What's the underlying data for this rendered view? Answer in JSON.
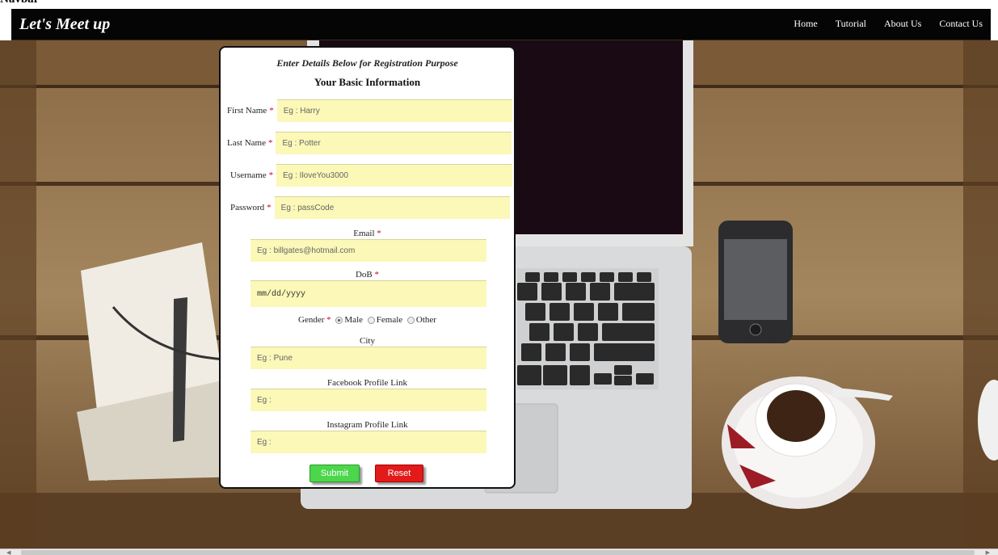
{
  "header": {
    "brand": "Let's Meet up",
    "partial_text": "Navbar"
  },
  "nav": [
    "Home",
    "Tutorial",
    "About Us",
    "Contact Us"
  ],
  "form": {
    "intro": "Enter Details Below for Registration Purpose",
    "heading": "Your Basic Information",
    "required_mark": "*",
    "first_name": {
      "label": "First Name",
      "placeholder": "Eg : Harry"
    },
    "last_name": {
      "label": "Last Name",
      "placeholder": "Eg : Potter"
    },
    "username": {
      "label": "Username",
      "placeholder": "Eg : IloveYou3000"
    },
    "password": {
      "label": "Password",
      "placeholder": "Eg : passCode"
    },
    "email": {
      "label": "Email",
      "placeholder": "Eg : billgates@hotmail.com"
    },
    "dob": {
      "label": "DoB",
      "placeholder": "mm/dd/yyyy"
    },
    "gender": {
      "label": "Gender",
      "options": [
        "Male",
        "Female",
        "Other"
      ],
      "selected": "Male"
    },
    "city": {
      "label": "City",
      "placeholder": "Eg : Pune"
    },
    "facebook": {
      "label": "Facebook Profile Link",
      "placeholder": "Eg :"
    },
    "instagram": {
      "label": "Instagram Profile Link",
      "placeholder": "Eg :"
    },
    "submit_label": "Submit",
    "reset_label": "Reset"
  },
  "colors": {
    "input_bg": "#fbf8b8",
    "submit": "#4cd64c",
    "reset": "#e21a1a",
    "required": "#d0021b"
  }
}
